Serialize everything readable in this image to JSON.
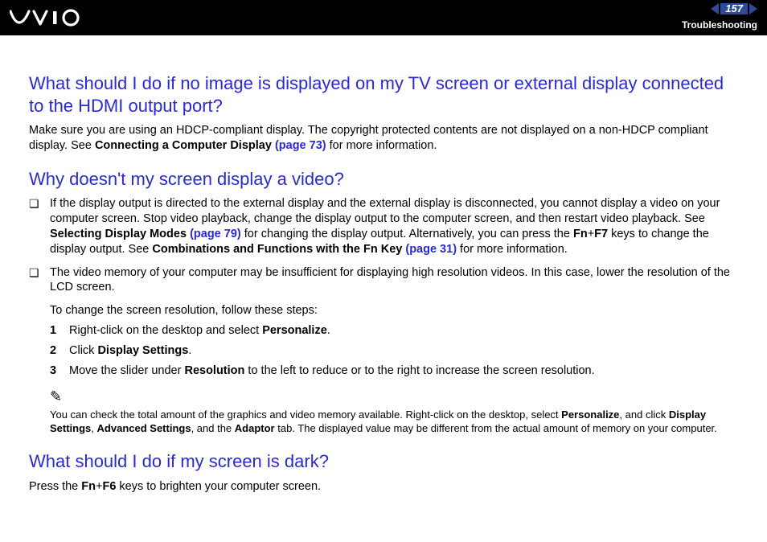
{
  "header": {
    "page_number": "157",
    "section": "Troubleshooting"
  },
  "q1": {
    "title": "What should I do if no image is displayed on my TV screen or external display connected to the HDMI output port?",
    "body_a": "Make sure you are using an HDCP-compliant display. The copyright protected contents are not displayed on a non-HDCP compliant display. See ",
    "body_bold": "Connecting a Computer Display ",
    "body_link": "(page 73)",
    "body_b": " for more information."
  },
  "q2": {
    "title": "Why doesn't my screen display a video?",
    "bullet1_a": "If the display output is directed to the external display and the external display is disconnected, you cannot display a video on your computer screen. Stop video playback, change the display output to the computer screen, and then restart video playback. See ",
    "bullet1_bold1": "Selecting Display Modes ",
    "bullet1_link1": "(page 79)",
    "bullet1_b": " for changing the display output. Alternatively, you can press the ",
    "bullet1_key1": "Fn",
    "bullet1_plus": "+",
    "bullet1_key2": "F7",
    "bullet1_c": " keys to change the display output. See ",
    "bullet1_bold2": "Combinations and Functions with the Fn Key ",
    "bullet1_link2": "(page 31)",
    "bullet1_d": " for more information.",
    "bullet2": "The video memory of your computer may be insufficient for displaying high resolution videos. In this case, lower the resolution of the LCD screen.",
    "steps_intro": "To change the screen resolution, follow these steps:",
    "step1_n": "1",
    "step1_a": "Right-click on the desktop and select ",
    "step1_b": "Personalize",
    "step1_c": ".",
    "step2_n": "2",
    "step2_a": "Click ",
    "step2_b": "Display Settings",
    "step2_c": ".",
    "step3_n": "3",
    "step3_a": "Move the slider under ",
    "step3_b": "Resolution",
    "step3_c": " to the left to reduce or to the right to increase the screen resolution.",
    "note_icon": "✎",
    "note_a": "You can check the total amount of the graphics and video memory available. Right-click on the desktop, select ",
    "note_b1": "Personalize",
    "note_b": ", and click ",
    "note_b2": "Display Settings",
    "note_c": ", ",
    "note_b3": "Advanced Settings",
    "note_d": ", and the ",
    "note_b4": "Adaptor",
    "note_e": " tab. The displayed value may be different from the actual amount of memory on your computer."
  },
  "q3": {
    "title": "What should I do if my screen is dark?",
    "body_a": "Press the ",
    "body_k1": "Fn",
    "body_plus": "+",
    "body_k2": "F6",
    "body_b": " keys to brighten your computer screen."
  }
}
